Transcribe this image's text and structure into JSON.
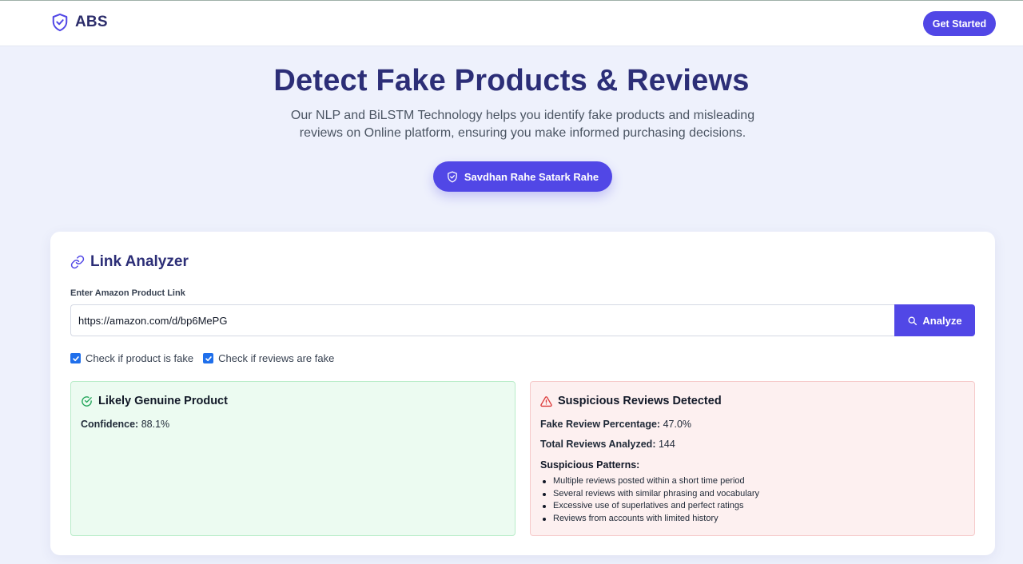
{
  "navbar": {
    "brand": "ABS",
    "cta_label": "Get Started"
  },
  "hero": {
    "title": "Detect Fake Products & Reviews",
    "subtitle": "Our NLP and BiLSTM Technology helps you identify fake products and misleading reviews on Online platform, ensuring you make informed purchasing decisions.",
    "button_label": "Savdhan Rahe Satark Rahe"
  },
  "analyzer": {
    "title": "Link Analyzer",
    "field_label": "Enter Amazon Product Link",
    "url_value": "https://amazon.com/d/bp6MePG",
    "analyze_label": "Analyze",
    "checks": [
      {
        "label": "Check if product is fake",
        "checked": true
      },
      {
        "label": "Check if reviews are fake",
        "checked": true
      }
    ]
  },
  "product_result": {
    "title": "Likely Genuine Product",
    "confidence_label": "Confidence:",
    "confidence_value": "88.1%"
  },
  "review_result": {
    "title": "Suspicious Reviews Detected",
    "fake_pct_label": "Fake Review Percentage:",
    "fake_pct_value": "47.0%",
    "total_label": "Total Reviews Analyzed:",
    "total_value": "144",
    "patterns_label": "Suspicious Patterns:",
    "patterns": [
      "Multiple reviews posted within a short time period",
      "Several reviews with similar phrasing and vocabulary",
      "Excessive use of superlatives and perfect ratings",
      "Reviews from accounts with limited history"
    ]
  },
  "icons": {
    "brand": "shield-check-icon",
    "hero_button": "shield-check-icon",
    "analyzer": "link-icon",
    "analyze": "search-icon",
    "product_result": "check-circle-icon",
    "review_result": "alert-triangle-icon"
  },
  "colors": {
    "accent": "#5147e6",
    "heading": "#2c2e77",
    "success_bg": "#ecfbf1",
    "success_icon": "#22a55a",
    "danger_bg": "#fdf0f0",
    "danger_icon": "#dc3b3b"
  }
}
